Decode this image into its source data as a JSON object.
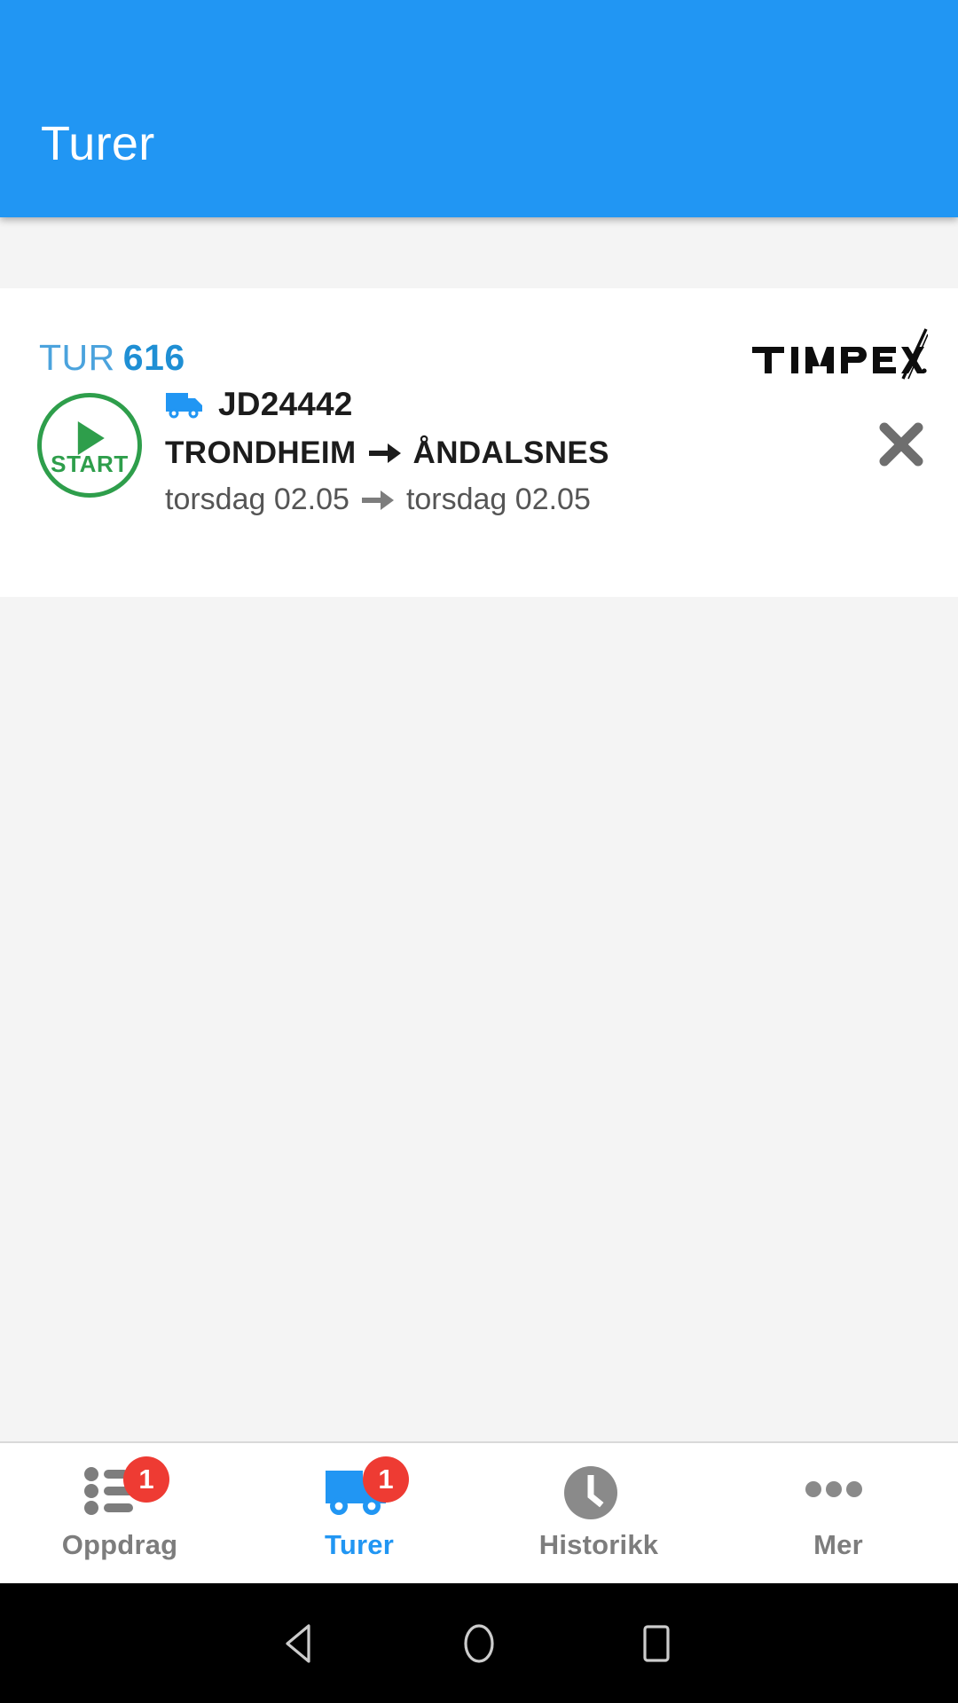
{
  "app": {
    "header": {
      "title": "Turer",
      "accent_color": "#2196f3"
    },
    "brand_logo_text": "TIMPEX"
  },
  "trip_card": {
    "tur_label": "TUR",
    "tur_number": "616",
    "start_button_label": "START",
    "start_icon": "play-icon",
    "start_color": "#2e9e4b",
    "vehicle_icon": "truck-icon",
    "vehicle_ref": "JD24442",
    "route": {
      "origin": "TRONDHEIM",
      "destination": "ÅNDALSNES",
      "arrow": "arrow-right-icon"
    },
    "dates": {
      "from": "torsdag 02.05",
      "to": "torsdag 02.05",
      "arrow": "arrow-right-icon"
    },
    "close_icon": "close-icon"
  },
  "tabbar": {
    "items": [
      {
        "label": "Oppdrag",
        "icon": "list-icon",
        "badge": "1",
        "active": false
      },
      {
        "label": "Turer",
        "icon": "truck-icon",
        "badge": "1",
        "active": true
      },
      {
        "label": "Historikk",
        "icon": "clock-icon",
        "badge": null,
        "active": false
      },
      {
        "label": "Mer",
        "icon": "ellipsis-icon",
        "badge": null,
        "active": false
      }
    ],
    "badge_color": "#ee3b33",
    "active_color": "#2196f3",
    "inactive_color": "#7d7d7d"
  },
  "system_nav": {
    "back": "back-triangle-icon",
    "home": "home-circle-icon",
    "recents": "recents-square-icon"
  }
}
